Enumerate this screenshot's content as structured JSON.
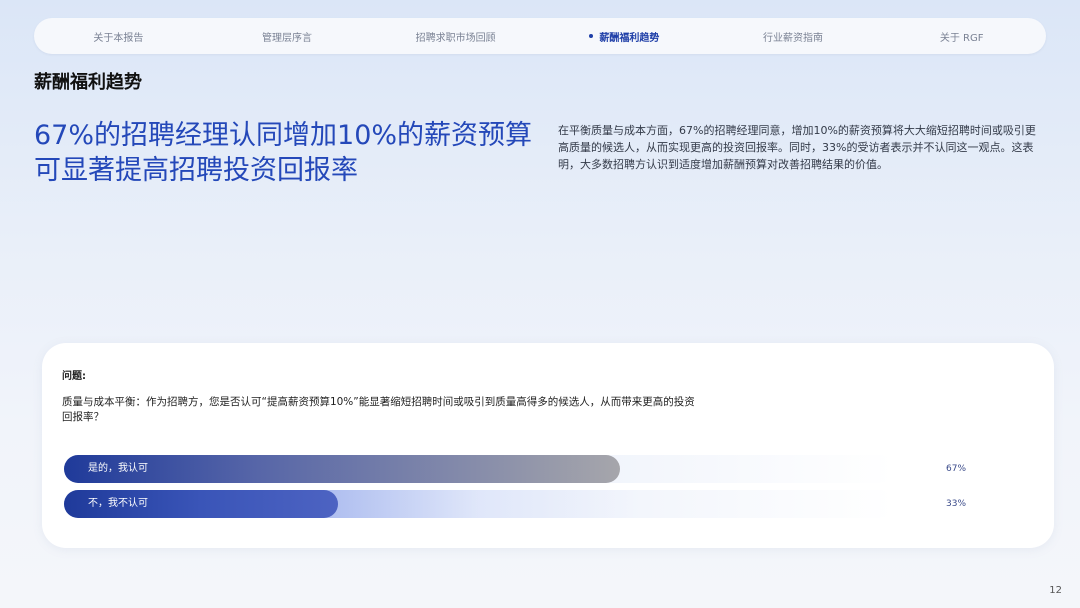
{
  "nav": {
    "items": [
      {
        "label": "关于本报告"
      },
      {
        "label": "管理层序言"
      },
      {
        "label": "招聘求职市场回顾"
      },
      {
        "label": "薪酬福利趋势"
      },
      {
        "label": "行业薪资指南"
      },
      {
        "label": "关于 RGF"
      }
    ],
    "active_index": 3
  },
  "section_title": "薪酬福利趋势",
  "headline": "67%的招聘经理认同增加10%的薪资预算可显著提高招聘投资回报率",
  "description": "在平衡质量与成本方面，67%的招聘经理同意，增加10%的薪资预算将大大缩短招聘时间或吸引更高质量的候选人，从而实现更高的投资回报率。同时，33%的受访者表示并不认同这一观点。这表明，大多数招聘方认识到适度增加薪酬预算对改善招聘结果的价值。",
  "survey": {
    "question_label": "问题:",
    "question_text": "质量与成本平衡：作为招聘方，您是否认可“提高薪资预算10%”能显著缩短招聘时间或吸引到质量高得多的候选人，从而带来更高的投资回报率？",
    "options": [
      {
        "label": "是的，我认可",
        "percent": 67,
        "percent_text": "67%"
      },
      {
        "label": "不，我不认可",
        "percent": 33,
        "percent_text": "33%"
      }
    ]
  },
  "page_number": "12",
  "colors": {
    "accent": "#2448b9",
    "bar_dark": "#1f3a9a",
    "bar_gray": "#a6a6ab"
  }
}
